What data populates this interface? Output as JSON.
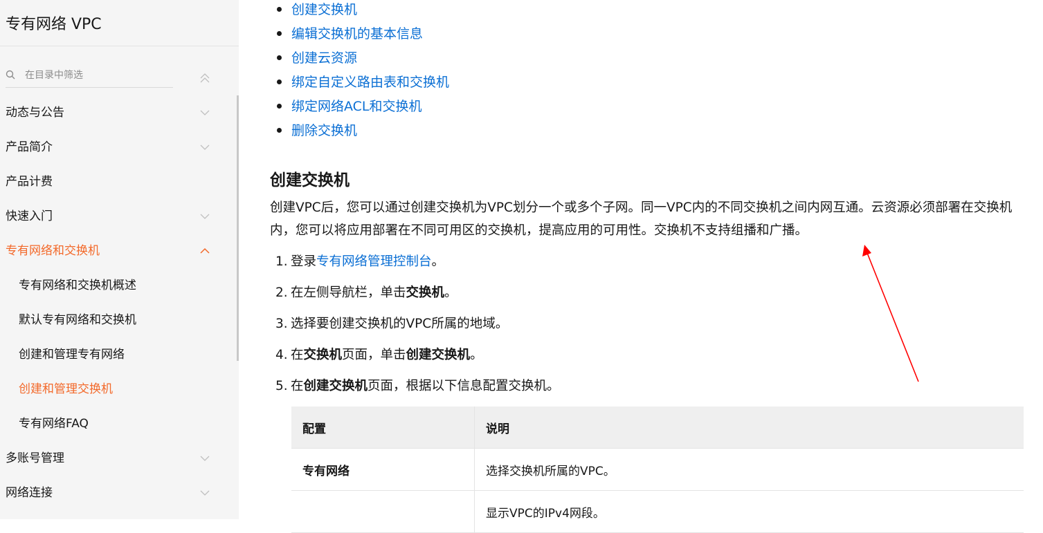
{
  "sidebar": {
    "product_title": "专有网络 VPC",
    "filter_placeholder": "在目录中筛选",
    "items": [
      {
        "label": "动态与公告"
      },
      {
        "label": "产品简介"
      },
      {
        "label": "产品计费"
      },
      {
        "label": "快速入门"
      },
      {
        "label": "专有网络和交换机"
      },
      {
        "label": "专有网络和交换机概述"
      },
      {
        "label": "默认专有网络和交换机"
      },
      {
        "label": "创建和管理专有网络"
      },
      {
        "label": "创建和管理交换机"
      },
      {
        "label": "专有网络FAQ"
      },
      {
        "label": "多账号管理"
      },
      {
        "label": "网络连接"
      }
    ],
    "active_color": "#f3692a"
  },
  "toc": [
    "创建交换机",
    "编辑交换机的基本信息",
    "创建云资源",
    "绑定自定义路由表和交换机",
    "绑定网络ACL和交换机",
    "删除交换机"
  ],
  "section": {
    "heading": "创建交换机",
    "body": "创建VPC后，您可以通过创建交换机为VPC划分一个或多个子网。同一VPC内的不同交换机之间内网互通。云资源必须部署在交换机内，您可以将应用部署在不同可用区的交换机，提高应用的可用性。交换机不支持组播和广播。"
  },
  "steps": {
    "s1_num": "1.",
    "s1_pre": "登录",
    "s1_link": "专有网络管理控制台",
    "s1_post": "。",
    "s2_num": "2.",
    "s2_pre": "在左侧导航栏，单击",
    "s2_bold": "交换机",
    "s2_post": "。",
    "s3_num": "3.",
    "s3_text": "选择要创建交换机的VPC所属的地域。",
    "s4_num": "4.",
    "s4_pre": "在",
    "s4_bold1": "交换机",
    "s4_mid": "页面，单击",
    "s4_bold2": "创建交换机",
    "s4_post": "。",
    "s5_num": "5.",
    "s5_pre": "在",
    "s5_bold": "创建交换机",
    "s5_post": "页面，根据以下信息配置交换机。"
  },
  "table": {
    "headers": [
      "配置",
      "说明"
    ],
    "rows": [
      [
        "专有网络",
        "选择交换机所属的VPC。"
      ],
      [
        "",
        "显示VPC的IPv4网段。"
      ]
    ]
  },
  "colors": {
    "link": "#0b6fd4",
    "annotation_arrow": "#ff0000"
  }
}
